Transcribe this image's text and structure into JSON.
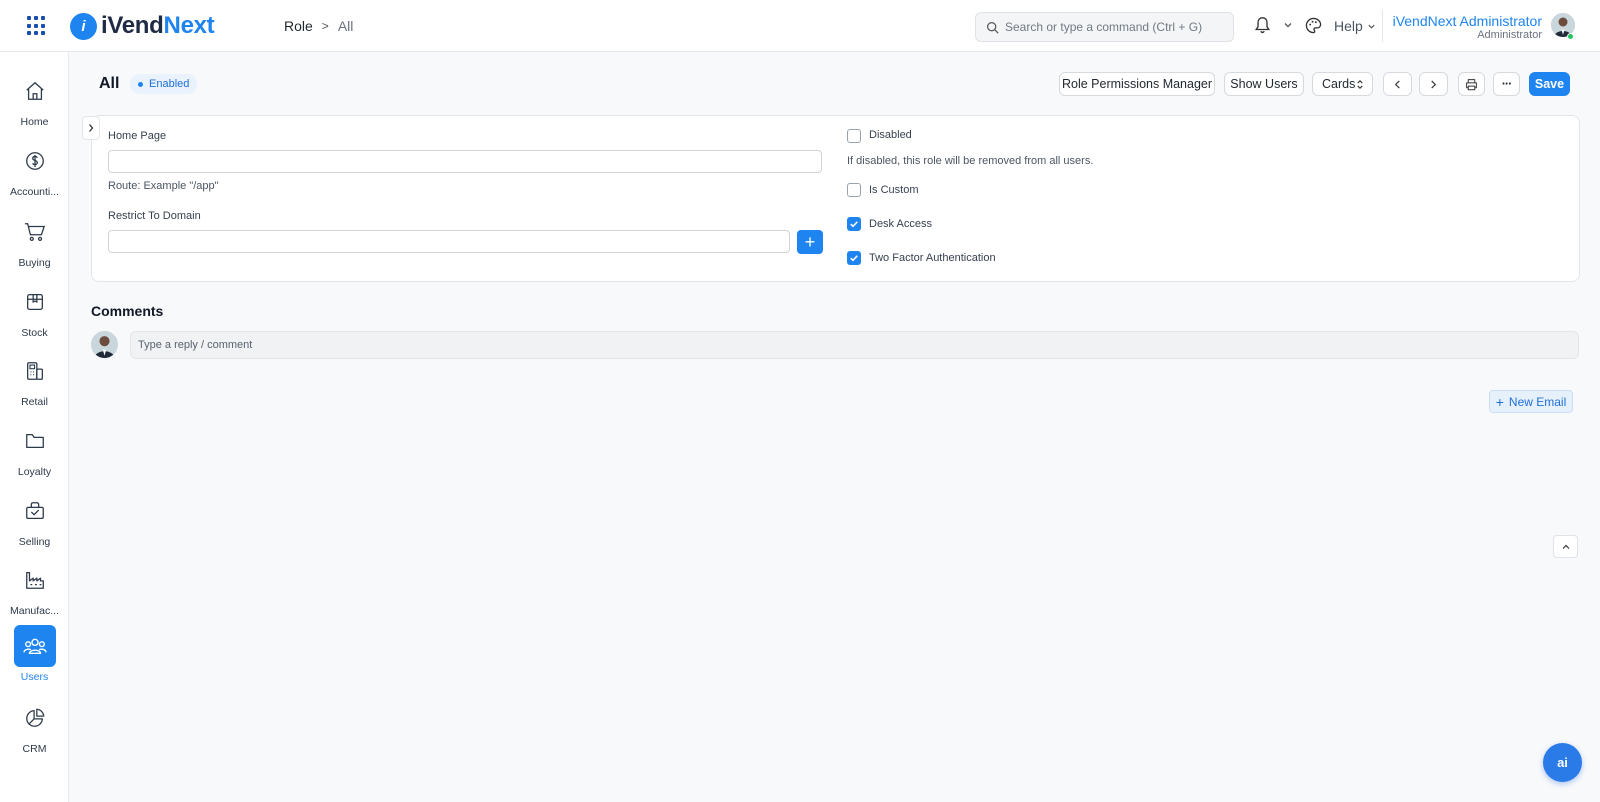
{
  "app": {
    "logo_letter": "i",
    "name_part1": "iVend",
    "name_part2": "Next"
  },
  "breadcrumb": {
    "parent": "Role",
    "separator": ">",
    "current": "All"
  },
  "search": {
    "placeholder": "Search or type a command (Ctrl + G)"
  },
  "navbar": {
    "help_label": "Help",
    "user_name": "iVendNext Administrator",
    "user_role": "Administrator"
  },
  "sidebar": {
    "items": [
      {
        "label": "Home",
        "icon": "home-icon"
      },
      {
        "label": "Accounti...",
        "icon": "dollar-icon"
      },
      {
        "label": "Buying",
        "icon": "cart-icon"
      },
      {
        "label": "Stock",
        "icon": "box-icon"
      },
      {
        "label": "Retail",
        "icon": "pos-icon"
      },
      {
        "label": "Loyalty",
        "icon": "folder-icon"
      },
      {
        "label": "Selling",
        "icon": "bag-icon"
      },
      {
        "label": "Manufac...",
        "icon": "factory-icon"
      },
      {
        "label": "Users",
        "icon": "users-icon",
        "active": true
      },
      {
        "label": "CRM",
        "icon": "pie-chart-icon"
      }
    ]
  },
  "page": {
    "title": "All",
    "status": "Enabled"
  },
  "toolbar": {
    "role_permissions_label": "Role Permissions Manager",
    "show_users_label": "Show Users",
    "view_select_value": "Cards",
    "more_label": "···",
    "save_label": "Save"
  },
  "form": {
    "home_page": {
      "label": "Home Page",
      "value": "",
      "help": "Route: Example \"/app\""
    },
    "restrict_to_domain": {
      "label": "Restrict To Domain",
      "value": "",
      "add_label": "+"
    },
    "disabled": {
      "label": "Disabled",
      "checked": false,
      "help": "If disabled, this role will be removed from all users."
    },
    "is_custom": {
      "label": "Is Custom",
      "checked": false
    },
    "desk_access": {
      "label": "Desk Access",
      "checked": true
    },
    "two_factor": {
      "label": "Two Factor Authentication",
      "checked": true
    }
  },
  "comments": {
    "title": "Comments",
    "placeholder": "Type a reply / comment"
  },
  "new_email": {
    "label": "New Email"
  },
  "ai_button": {
    "label": "ai"
  },
  "colors": {
    "accent": "#1e84f0",
    "brand_dark": "#1f2a44",
    "status_bg": "#eaf2fe"
  }
}
